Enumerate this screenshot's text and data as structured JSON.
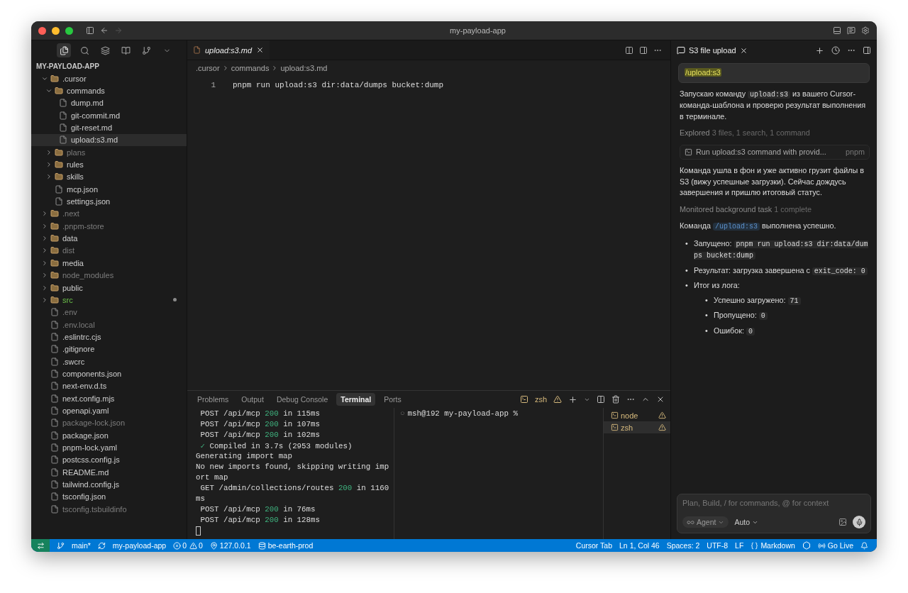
{
  "window": {
    "title": "my-payload-app"
  },
  "explorer": {
    "title": "MY-PAYLOAD-APP",
    "items": [
      {
        "name": ".cursor",
        "kind": "folder",
        "expanded": true,
        "selected": false,
        "dimmed": false,
        "modified": false,
        "children": [
          {
            "name": "commands",
            "kind": "folder",
            "expanded": true,
            "selected": false,
            "dimmed": false,
            "modified": false,
            "children": [
              {
                "name": "dump.md",
                "kind": "file",
                "selected": false,
                "dimmed": false,
                "modified": false
              },
              {
                "name": "git-commit.md",
                "kind": "file",
                "selected": false,
                "dimmed": false,
                "modified": false
              },
              {
                "name": "git-reset.md",
                "kind": "file",
                "selected": false,
                "dimmed": false,
                "modified": false
              },
              {
                "name": "upload:s3.md",
                "kind": "file",
                "selected": true,
                "dimmed": false,
                "modified": false
              }
            ]
          },
          {
            "name": "plans",
            "kind": "folder",
            "expanded": false,
            "selected": false,
            "dimmed": true,
            "modified": false
          },
          {
            "name": "rules",
            "kind": "folder",
            "expanded": false,
            "selected": false,
            "dimmed": false,
            "modified": false
          },
          {
            "name": "skills",
            "kind": "folder",
            "expanded": false,
            "selected": false,
            "dimmed": false,
            "modified": false
          },
          {
            "name": "mcp.json",
            "kind": "file",
            "selected": false,
            "dimmed": false,
            "modified": false
          },
          {
            "name": "settings.json",
            "kind": "file",
            "selected": false,
            "dimmed": false,
            "modified": false
          }
        ]
      },
      {
        "name": ".next",
        "kind": "folder",
        "expanded": false,
        "selected": false,
        "dimmed": true,
        "modified": false
      },
      {
        "name": ".pnpm-store",
        "kind": "folder",
        "expanded": false,
        "selected": false,
        "dimmed": true,
        "modified": false
      },
      {
        "name": "data",
        "kind": "folder",
        "expanded": false,
        "selected": false,
        "dimmed": false,
        "modified": false
      },
      {
        "name": "dist",
        "kind": "folder",
        "expanded": false,
        "selected": false,
        "dimmed": true,
        "modified": false
      },
      {
        "name": "media",
        "kind": "folder",
        "expanded": false,
        "selected": false,
        "dimmed": false,
        "modified": false
      },
      {
        "name": "node_modules",
        "kind": "folder",
        "expanded": false,
        "selected": false,
        "dimmed": true,
        "modified": false
      },
      {
        "name": "public",
        "kind": "folder",
        "expanded": false,
        "selected": false,
        "dimmed": false,
        "modified": false
      },
      {
        "name": "src",
        "kind": "folder",
        "expanded": false,
        "selected": false,
        "dimmed": false,
        "modified": true
      },
      {
        "name": ".env",
        "kind": "file",
        "selected": false,
        "dimmed": true,
        "modified": false
      },
      {
        "name": ".env.local",
        "kind": "file",
        "selected": false,
        "dimmed": true,
        "modified": false
      },
      {
        "name": ".eslintrc.cjs",
        "kind": "file",
        "selected": false,
        "dimmed": false,
        "modified": false
      },
      {
        "name": ".gitignore",
        "kind": "file",
        "selected": false,
        "dimmed": false,
        "modified": false
      },
      {
        "name": ".swcrc",
        "kind": "file",
        "selected": false,
        "dimmed": false,
        "modified": false
      },
      {
        "name": "components.json",
        "kind": "file",
        "selected": false,
        "dimmed": false,
        "modified": false
      },
      {
        "name": "next-env.d.ts",
        "kind": "file",
        "selected": false,
        "dimmed": false,
        "modified": false
      },
      {
        "name": "next.config.mjs",
        "kind": "file",
        "selected": false,
        "dimmed": false,
        "modified": false
      },
      {
        "name": "openapi.yaml",
        "kind": "file",
        "selected": false,
        "dimmed": false,
        "modified": false
      },
      {
        "name": "package-lock.json",
        "kind": "file",
        "selected": false,
        "dimmed": true,
        "modified": false
      },
      {
        "name": "package.json",
        "kind": "file",
        "selected": false,
        "dimmed": false,
        "modified": false
      },
      {
        "name": "pnpm-lock.yaml",
        "kind": "file",
        "selected": false,
        "dimmed": false,
        "modified": false
      },
      {
        "name": "postcss.config.js",
        "kind": "file",
        "selected": false,
        "dimmed": false,
        "modified": false
      },
      {
        "name": "README.md",
        "kind": "file",
        "selected": false,
        "dimmed": false,
        "modified": false
      },
      {
        "name": "tailwind.config.js",
        "kind": "file",
        "selected": false,
        "dimmed": false,
        "modified": false
      },
      {
        "name": "tsconfig.json",
        "kind": "file",
        "selected": false,
        "dimmed": false,
        "modified": false
      },
      {
        "name": "tsconfig.tsbuildinfo",
        "kind": "file",
        "selected": false,
        "dimmed": true,
        "modified": false
      }
    ]
  },
  "editor": {
    "tab": {
      "label": "upload:s3.md",
      "preview": true
    },
    "breadcrumb": [
      ".cursor",
      "commands",
      "upload:s3.md"
    ],
    "lines": [
      {
        "number": "1",
        "text": "pnpm run upload:s3 dir:data/dumps bucket:dump"
      }
    ]
  },
  "panel": {
    "tabs": [
      {
        "label": "Problems",
        "selected": false
      },
      {
        "label": "Output",
        "selected": false
      },
      {
        "label": "Debug Console",
        "selected": false
      },
      {
        "label": "Terminal",
        "selected": true
      },
      {
        "label": "Ports",
        "selected": false
      }
    ],
    "active_shell": "zsh",
    "output": [
      {
        "kind": "request",
        "before": "POST /api/mcp ",
        "code": "200",
        "after": " in 115ms"
      },
      {
        "kind": "request",
        "before": "POST /api/mcp ",
        "code": "200",
        "after": " in 107ms"
      },
      {
        "kind": "request",
        "before": "POST /api/mcp ",
        "code": "200",
        "after": " in 102ms"
      },
      {
        "kind": "success",
        "mark": "✓",
        "text": "Compiled in 3.7s (2953 modules)"
      },
      {
        "kind": "plain",
        "text": "Generating import map"
      },
      {
        "kind": "plain",
        "text": "No new imports found, skipping writing imp"
      },
      {
        "kind": "plain",
        "text": "ort map"
      },
      {
        "kind": "request",
        "before": "GET /admin/collections/routes ",
        "code": "200",
        "after": " in 1160"
      },
      {
        "kind": "plain",
        "text": "ms"
      },
      {
        "kind": "request",
        "before": "POST /api/mcp ",
        "code": "200",
        "after": " in 76ms"
      },
      {
        "kind": "request",
        "before": "POST /api/mcp ",
        "code": "200",
        "after": " in 128ms"
      }
    ],
    "prompt_mark": "○",
    "prompt": "msh@192 my-payload-app %",
    "terminals": [
      {
        "label": "node",
        "selected": false
      },
      {
        "label": "zsh",
        "selected": true
      }
    ]
  },
  "chat": {
    "tab": "S3 file upload",
    "user_message": "/upload:s3",
    "blocks": [
      {
        "kind": "paragraph",
        "segments": [
          {
            "text": "Запускаю команду "
          },
          {
            "code": "upload:s3"
          },
          {
            "text": " из вашего Cursor-команда-шаблона и проверю результат выполнения в терминале."
          }
        ]
      },
      {
        "kind": "activity",
        "label": "Explored",
        "detail": "3 files, 1 search, 1 command"
      },
      {
        "kind": "tool",
        "text": "Run upload:s3 command with provid...",
        "tag": "pnpm"
      },
      {
        "kind": "paragraph",
        "segments": [
          {
            "text": "Команда ушла в фон и уже активно грузит файлы в S3 (вижу успешные загрузки). Сейчас дождусь завершения и пришлю итоговый статус."
          }
        ]
      },
      {
        "kind": "activity",
        "label": "Monitored background task",
        "detail": "1 complete"
      },
      {
        "kind": "paragraph",
        "segments": [
          {
            "text": "Команда "
          },
          {
            "link": "/upload:s3"
          },
          {
            "text": " выполнена успешно."
          }
        ]
      },
      {
        "kind": "list",
        "items": [
          {
            "marker": "•",
            "segments": [
              {
                "text": "Запущено: "
              },
              {
                "code": "pnpm run upload:s3 dir:data/dumps bucket:dump"
              }
            ]
          },
          {
            "marker": "•",
            "segments": [
              {
                "text": "Результат: загрузка завершена с "
              },
              {
                "code": "exit_code: 0"
              }
            ]
          },
          {
            "marker": "•",
            "segments": [
              {
                "text": "Итог из лога:"
              }
            ],
            "children": [
              {
                "marker": "•",
                "segments": [
                  {
                    "text": "Успешно загружено: "
                  },
                  {
                    "code": "71"
                  }
                ]
              },
              {
                "marker": "•",
                "segments": [
                  {
                    "text": "Пропущено: "
                  },
                  {
                    "code": "0"
                  }
                ]
              },
              {
                "marker": "•",
                "segments": [
                  {
                    "text": "Ошибок: "
                  },
                  {
                    "code": "0"
                  }
                ]
              }
            ]
          }
        ]
      }
    ],
    "composer": {
      "placeholder": "Plan, Build, / for commands, @ for context",
      "mode": "Agent",
      "model": "Auto"
    }
  },
  "status_bar": {
    "branch": "main*",
    "project": "my-payload-app",
    "errors": "0",
    "warnings": "0",
    "host": "127.0.0.1",
    "database": "be-earth-prod",
    "right": [
      "Cursor Tab",
      "Ln 1, Col 46",
      "Spaces: 2",
      "UTF-8",
      "LF"
    ],
    "language": "Markdown",
    "live": "Go Live"
  }
}
